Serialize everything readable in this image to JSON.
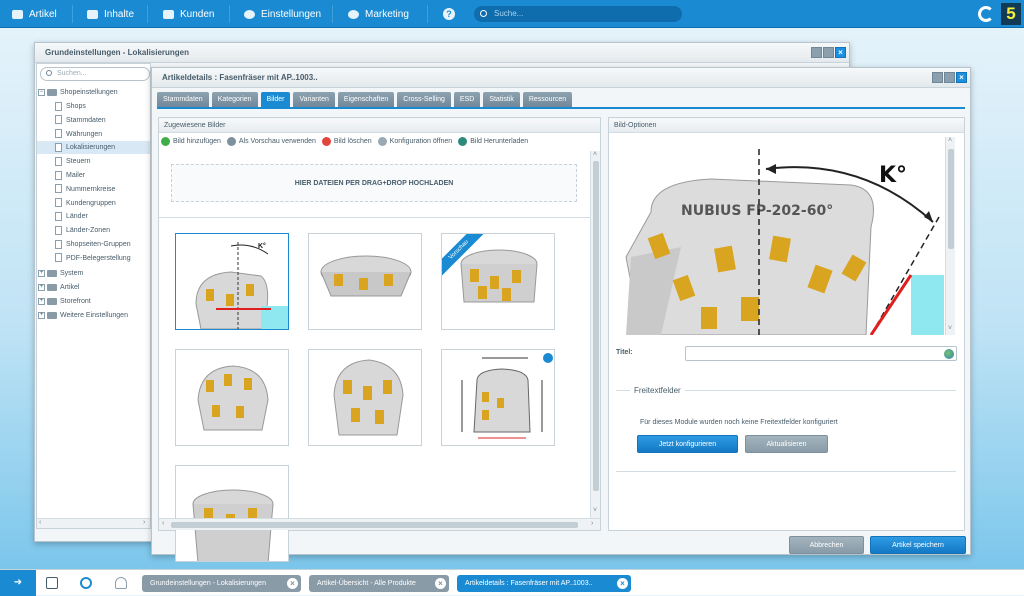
{
  "topnav": {
    "items": [
      {
        "label": "Artikel",
        "icon": "article-icon"
      },
      {
        "label": "Inhalte",
        "icon": "content-icon"
      },
      {
        "label": "Kunden",
        "icon": "customers-icon"
      },
      {
        "label": "Einstellungen",
        "icon": "gear-icon"
      },
      {
        "label": "Marketing",
        "icon": "pie-chart-icon"
      }
    ],
    "search_placeholder": "Suche...",
    "brand_accent": "#1a8bd3"
  },
  "back_window": {
    "title": "Grundeinstellungen - Lokalisierungen"
  },
  "tree": {
    "search_placeholder": "Suchen...",
    "root": {
      "label": "Shopeinstellungen",
      "toggle": "−"
    },
    "children": [
      "Shops",
      "Stammdaten",
      "Währungen",
      "Lokalisierungen",
      "Steuern",
      "Mailer",
      "Nummernkreise",
      "Kundengruppen",
      "Länder",
      "Länder-Zonen",
      "Shopseiten-Gruppen",
      "PDF-Belegerstellung"
    ],
    "selected": "Lokalisierungen",
    "folders": [
      "System",
      "Artikel",
      "Storefront",
      "Weitere Einstellungen"
    ],
    "folder_toggle": "+"
  },
  "main_window": {
    "title": "Artikeldetails : Fasenfräser mit AP..1003..",
    "tabs": [
      "Stammdaten",
      "Kategorien",
      "Bilder",
      "Varianten",
      "Eigenschaften",
      "Cross-Selling",
      "ESD",
      "Statistik",
      "Ressourcen"
    ],
    "active_tab": "Bilder"
  },
  "images_panel": {
    "title": "Zugewiesene Bilder",
    "toolbar": [
      {
        "label": "Bild hinzufügen",
        "icon": "add-icon",
        "color": "#3fae49"
      },
      {
        "label": "Als Vorschau verwenden",
        "icon": "preview-icon",
        "color": "#7c909d"
      },
      {
        "label": "Bild löschen",
        "icon": "delete-icon",
        "color": "#e0463c"
      },
      {
        "label": "Konfiguration öffnen",
        "icon": "config-icon",
        "color": "#9aaab5"
      },
      {
        "label": "Bild Herunterladen",
        "icon": "download-icon",
        "color": "#2d8a7a"
      }
    ],
    "dropzone": "HIER DATEIEN PER DRAG+DROP HOCHLADEN",
    "preview_badge": "Vorschau",
    "thumbnail_count": 7
  },
  "options_panel": {
    "title": "Bild-Optionen",
    "preview_text": {
      "angle_label": "K°",
      "engraving": "NUBIUS  FP-202-60°"
    },
    "title_label": "Titel:",
    "title_value": "",
    "freitext_legend": "Freitextfelder",
    "freitext_message": "Für dieses Module wurden noch keine Freitextfelder konfiguriert",
    "btn_configure": "Jetzt konfigurieren",
    "btn_refresh": "Aktualisieren"
  },
  "footer": {
    "cancel": "Abbrechen",
    "save": "Artikel speichern"
  },
  "taskbar": {
    "tasks": [
      {
        "label": "Grundeinstellungen - Lokalisierungen",
        "active": false
      },
      {
        "label": "Artikel-Übersicht - Alle Produkte",
        "active": false
      },
      {
        "label": "Artikeldetails : Fasenfräser mit AP..1003..",
        "active": true
      }
    ],
    "close_glyph": "×"
  }
}
